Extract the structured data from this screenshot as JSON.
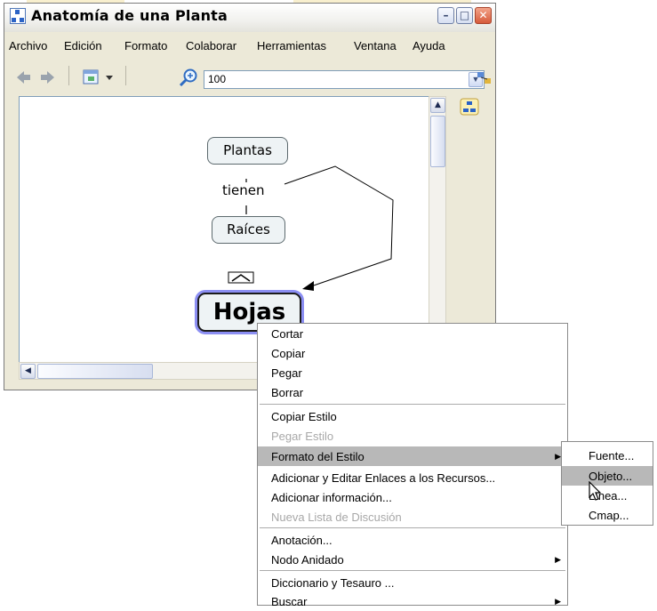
{
  "window": {
    "title": "Anatomía de una Planta",
    "controls": {
      "minimize": "–",
      "maximize": "□",
      "close": "✕"
    }
  },
  "menubar": [
    "Archivo",
    "Edición",
    "Formato",
    "Colaborar",
    "Herramientas",
    "Ventana",
    "Ayuda"
  ],
  "toolbar": {
    "back_icon": "back-arrow-icon",
    "forward_icon": "forward-arrow-icon",
    "zoom_value": "100"
  },
  "concept_map": {
    "nodes": {
      "plantas": "Plantas",
      "raices": "Raíces",
      "hojas": "Hojas"
    },
    "linking_phrase": "tienen"
  },
  "context_menu": {
    "items": [
      {
        "label": "Cortar",
        "enabled": true
      },
      {
        "label": "Copiar",
        "enabled": true
      },
      {
        "label": "Pegar",
        "enabled": true
      },
      {
        "label": "Borrar",
        "enabled": true
      },
      {
        "label": "Copiar Estilo",
        "enabled": true
      },
      {
        "label": "Pegar Estilo",
        "enabled": false
      },
      {
        "label": "Formato del Estilo",
        "enabled": true,
        "submenu": true,
        "highlighted": true
      },
      {
        "label": "Adicionar y Editar Enlaces a los Recursos...",
        "enabled": true
      },
      {
        "label": "Adicionar información...",
        "enabled": true
      },
      {
        "label": "Nueva Lista de Discusión",
        "enabled": false
      },
      {
        "label": "Anotación...",
        "enabled": true
      },
      {
        "label": "Nodo Anidado",
        "enabled": true,
        "submenu": true
      },
      {
        "label": "Diccionario y Tesauro ...",
        "enabled": true
      },
      {
        "label": "Buscar",
        "enabled": true,
        "submenu": true
      }
    ]
  },
  "submenu": {
    "items": [
      {
        "label": "Fuente...",
        "highlighted": false
      },
      {
        "label": "Objeto...",
        "highlighted": true
      },
      {
        "label": "Línea...",
        "highlighted": false
      },
      {
        "label": "Cmap...",
        "highlighted": false
      }
    ]
  },
  "colors": {
    "menu_highlight": "#b8b8b8",
    "selection_glow": "#8c8ff3",
    "node_fill": "#eef3f5",
    "window_bg": "#ece9d8"
  }
}
